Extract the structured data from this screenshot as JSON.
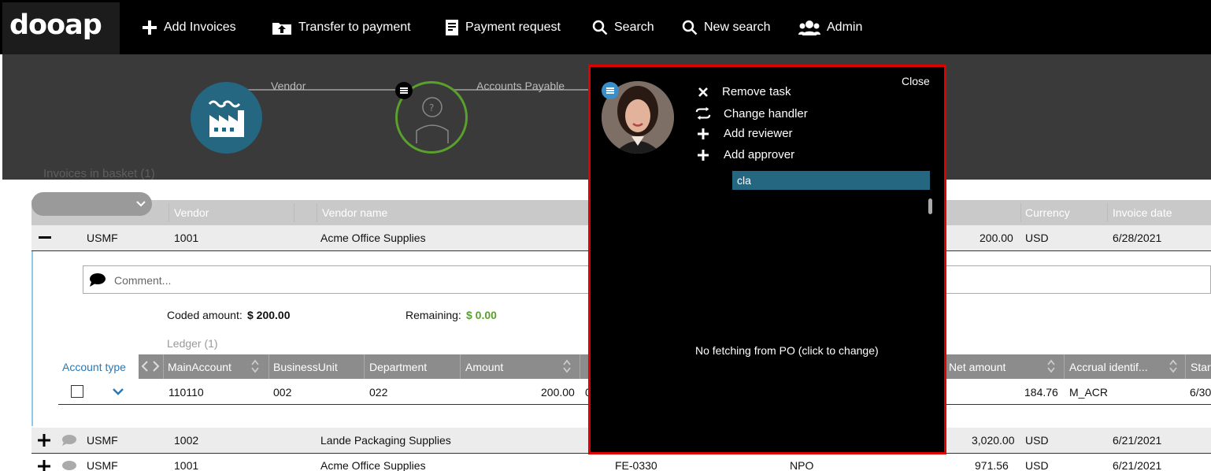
{
  "app": {
    "logo": "dooap"
  },
  "nav": {
    "items": [
      {
        "label": "Add Invoices",
        "icon": "plus-icon"
      },
      {
        "label": "Transfer to payment",
        "icon": "upload-folder-icon"
      },
      {
        "label": "Payment request",
        "icon": "document-icon"
      },
      {
        "label": "Search",
        "icon": "search-icon"
      },
      {
        "label": "New search",
        "icon": "search-icon"
      },
      {
        "label": "Admin",
        "icon": "users-icon"
      }
    ]
  },
  "workflow": {
    "steps": [
      {
        "label": "Vendor",
        "icon": "factory-icon"
      },
      {
        "label": "Accounts Payable",
        "icon": "unknown-person-icon"
      }
    ]
  },
  "grid": {
    "title_partial": "Invoices in basket (1)",
    "columns": [
      "Vendor",
      "Vendor name",
      "Currency",
      "Invoice date"
    ],
    "rows": [
      {
        "company": "USMF",
        "vendor": "1001",
        "vendor_name": "Acme Office Supplies",
        "amount": "200.00",
        "currency": "USD",
        "date": "6/28/2021"
      },
      {
        "company": "USMF",
        "vendor": "1002",
        "vendor_name": "Lande Packaging Supplies",
        "amount": "3,020.00",
        "currency": "USD",
        "date": "6/21/2021"
      },
      {
        "company": "USMF",
        "vendor": "1001",
        "vendor_name": "Acme Office Supplies",
        "col4": "FE-0330",
        "col5": "NPO",
        "amount": "971.56",
        "currency": "USD",
        "date": "6/21/2021"
      }
    ],
    "expanded": {
      "comment_placeholder": "Comment...",
      "coded_amount_label": "Coded amount:",
      "coded_amount_value": "$ 200.00",
      "remaining_label": "Remaining:",
      "remaining_value": "$ 0.00",
      "ledger_label": "Ledger (1)",
      "account_type_label": "Account type",
      "ledger_columns": [
        "MainAccount",
        "BusinessUnit",
        "Department",
        "Amount",
        "Net amount",
        "Accrual identif...",
        "Star"
      ],
      "ledger_row": {
        "main_account": "110110",
        "business_unit": "002",
        "department": "022",
        "amount": "200.00",
        "amount_tail": "0",
        "net_amount": "184.76",
        "accrual": "M_ACR",
        "start": "6/30"
      }
    }
  },
  "popup": {
    "close_label": "Close",
    "menu": [
      {
        "label": "Remove task",
        "icon": "x-icon"
      },
      {
        "label": "Change handler",
        "icon": "swap-icon"
      },
      {
        "label": "Add reviewer",
        "icon": "plus-icon"
      },
      {
        "label": "Add approver",
        "icon": "plus-icon"
      }
    ],
    "search_value": "cla",
    "po_text": "No fetching from PO (click to change)"
  },
  "colors": {
    "accent_teal": "#256680",
    "positive_green": "#5aa02c",
    "popup_border": "#e00000"
  }
}
